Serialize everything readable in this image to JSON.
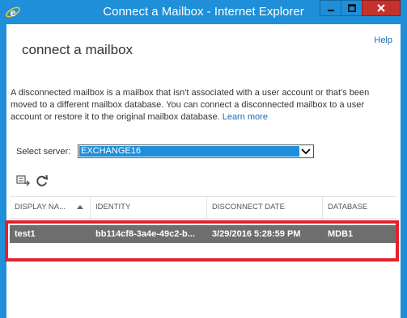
{
  "window": {
    "title": "Connect a Mailbox - Internet Explorer",
    "icon": "internet-explorer-icon",
    "accent_color": "#1E8FD8",
    "close_color": "#C7312B"
  },
  "page": {
    "help": "Help",
    "title": "connect a mailbox",
    "description": "A disconnected mailbox is a mailbox that isn't associated with a user account or that's been moved to a different mailbox database. You can connect a disconnected mailbox to a user account or restore it to the original mailbox database.",
    "learn_more": "Learn more"
  },
  "server": {
    "label": "Select server:",
    "selected": "EXCHANGE16",
    "selection_color": "#1F8FD9"
  },
  "toolbar": {
    "icons": [
      "connect-icon",
      "refresh-icon"
    ]
  },
  "grid": {
    "columns": [
      "DISPLAY NA...",
      "IDENTITY",
      "DISCONNECT DATE",
      "DATABASE"
    ],
    "sort_column": "DISPLAY NA...",
    "rows": [
      {
        "display_name": "test1",
        "identity": "bb114cf8-3a4e-49c2-b...",
        "disconnect_date": "3/29/2016 5:28:59 PM",
        "database": "MDB1",
        "selected": true
      }
    ],
    "selected_row_color": "#6E6E6E",
    "highlight_color": "#E3212B"
  }
}
